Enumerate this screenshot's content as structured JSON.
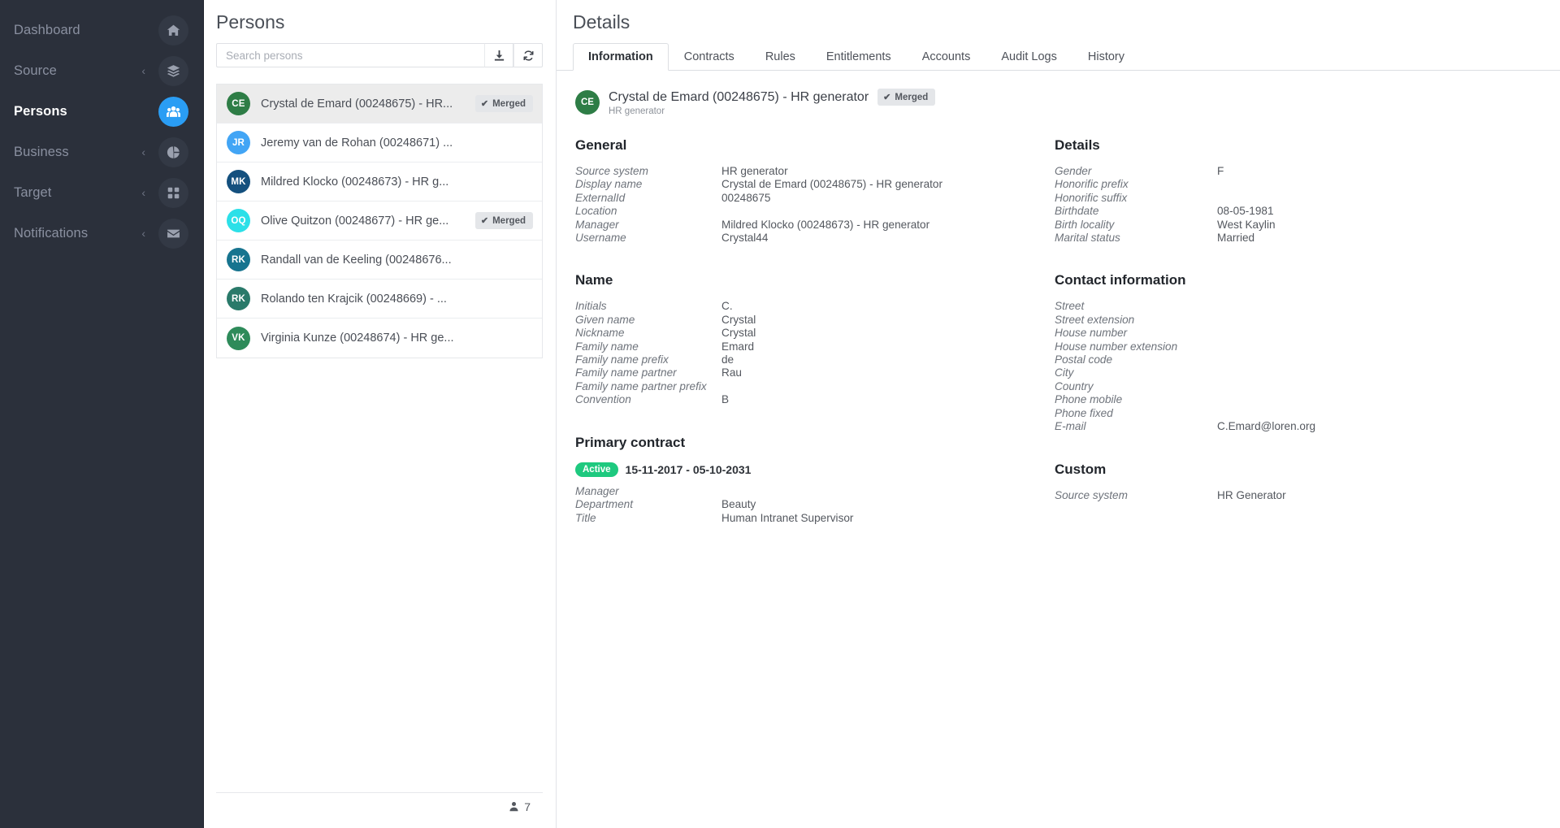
{
  "sidebar": {
    "items": [
      {
        "label": "Dashboard",
        "icon": "home-icon",
        "caret": false,
        "active": false
      },
      {
        "label": "Source",
        "icon": "layers-icon",
        "caret": true,
        "active": false
      },
      {
        "label": "Persons",
        "icon": "people-icon",
        "caret": false,
        "active": true
      },
      {
        "label": "Business",
        "icon": "pie-icon",
        "caret": true,
        "active": false
      },
      {
        "label": "Target",
        "icon": "grid-icon",
        "caret": true,
        "active": false
      },
      {
        "label": "Notifications",
        "icon": "envelope-icon",
        "caret": true,
        "active": false
      }
    ],
    "caret_glyph": "‹",
    "accent_color": "#2a9df4",
    "background_color": "#2b303b"
  },
  "list_panel": {
    "title": "Persons",
    "search": {
      "placeholder": "Search persons",
      "value": ""
    },
    "download_button_label": "download-icon",
    "refresh_button_label": "refresh-icon",
    "merged_label": "Merged",
    "merged_check": "✔",
    "count": "7",
    "persons": [
      {
        "initials": "CE",
        "name": "Crystal de Emard (00248675) - HR...",
        "color": "#2e7d46",
        "merged": true,
        "selected": true
      },
      {
        "initials": "JR",
        "name": "Jeremy van de Rohan (00248671) ...",
        "color": "#42a5f5",
        "merged": false,
        "selected": false
      },
      {
        "initials": "MK",
        "name": "Mildred Klocko (00248673) - HR g...",
        "color": "#14507e",
        "merged": false,
        "selected": false
      },
      {
        "initials": "OQ",
        "name": "Olive Quitzon (00248677) - HR ge...",
        "color": "#2ce0e8",
        "merged": true,
        "selected": false
      },
      {
        "initials": "RK",
        "name": "Randall van de Keeling (00248676...",
        "color": "#17748f",
        "merged": false,
        "selected": false
      },
      {
        "initials": "RK",
        "name": "Rolando ten Krajcik (00248669) - ...",
        "color": "#2a7a6a",
        "merged": false,
        "selected": false
      },
      {
        "initials": "VK",
        "name": "Virginia Kunze (00248674) - HR ge...",
        "color": "#2e8b5a",
        "merged": false,
        "selected": false
      }
    ]
  },
  "details": {
    "title": "Details",
    "tabs": [
      {
        "label": "Information",
        "active": true
      },
      {
        "label": "Contracts",
        "active": false
      },
      {
        "label": "Rules",
        "active": false
      },
      {
        "label": "Entitlements",
        "active": false
      },
      {
        "label": "Accounts",
        "active": false
      },
      {
        "label": "Audit Logs",
        "active": false
      },
      {
        "label": "History",
        "active": false
      }
    ],
    "entity": {
      "initials": "CE",
      "avatar_color": "#2e7d46",
      "title": "Crystal de Emard (00248675) - HR generator",
      "subtitle": "HR generator",
      "badge": "Merged",
      "badge_check": "✔"
    },
    "sections": {
      "general": {
        "heading": "General",
        "rows": [
          {
            "key": "Source system",
            "value": "HR generator"
          },
          {
            "key": "Display name",
            "value": "Crystal de Emard (00248675) - HR generator"
          },
          {
            "key": "ExternalId",
            "value": "00248675"
          },
          {
            "key": "Location",
            "value": ""
          },
          {
            "key": "Manager",
            "value": "Mildred Klocko (00248673) - HR generator"
          },
          {
            "key": "Username",
            "value": "Crystal44"
          }
        ]
      },
      "name": {
        "heading": "Name",
        "rows": [
          {
            "key": "Initials",
            "value": "C."
          },
          {
            "key": "Given name",
            "value": "Crystal"
          },
          {
            "key": "Nickname",
            "value": "Crystal"
          },
          {
            "key": "Family name",
            "value": "Emard"
          },
          {
            "key": "Family name prefix",
            "value": "de"
          },
          {
            "key": "Family name partner",
            "value": "Rau"
          },
          {
            "key": "Family name partner prefix",
            "value": ""
          },
          {
            "key": "Convention",
            "value": "B"
          }
        ]
      },
      "primary_contract": {
        "heading": "Primary contract",
        "status_badge": "Active",
        "dates": "15-11-2017 - 05-10-2031",
        "rows": [
          {
            "key": "Manager",
            "value": ""
          },
          {
            "key": "Department",
            "value": "Beauty"
          },
          {
            "key": "Title",
            "value": "Human Intranet Supervisor"
          }
        ]
      },
      "details": {
        "heading": "Details",
        "rows": [
          {
            "key": "Gender",
            "value": "F"
          },
          {
            "key": "Honorific prefix",
            "value": ""
          },
          {
            "key": "Honorific suffix",
            "value": ""
          },
          {
            "key": "Birthdate",
            "value": "08-05-1981"
          },
          {
            "key": "Birth locality",
            "value": "West Kaylin"
          },
          {
            "key": "Marital status",
            "value": "Married"
          }
        ]
      },
      "contact_information": {
        "heading": "Contact information",
        "rows": [
          {
            "key": "Street",
            "value": ""
          },
          {
            "key": "Street extension",
            "value": ""
          },
          {
            "key": "House number",
            "value": ""
          },
          {
            "key": "House number extension",
            "value": ""
          },
          {
            "key": "Postal code",
            "value": ""
          },
          {
            "key": "City",
            "value": ""
          },
          {
            "key": "Country",
            "value": ""
          },
          {
            "key": "Phone mobile",
            "value": ""
          },
          {
            "key": "Phone fixed",
            "value": ""
          },
          {
            "key": "E-mail",
            "value": "C.Emard@loren.org"
          }
        ]
      },
      "custom": {
        "heading": "Custom",
        "rows": [
          {
            "key": "Source system",
            "value": "HR Generator"
          }
        ]
      }
    }
  }
}
